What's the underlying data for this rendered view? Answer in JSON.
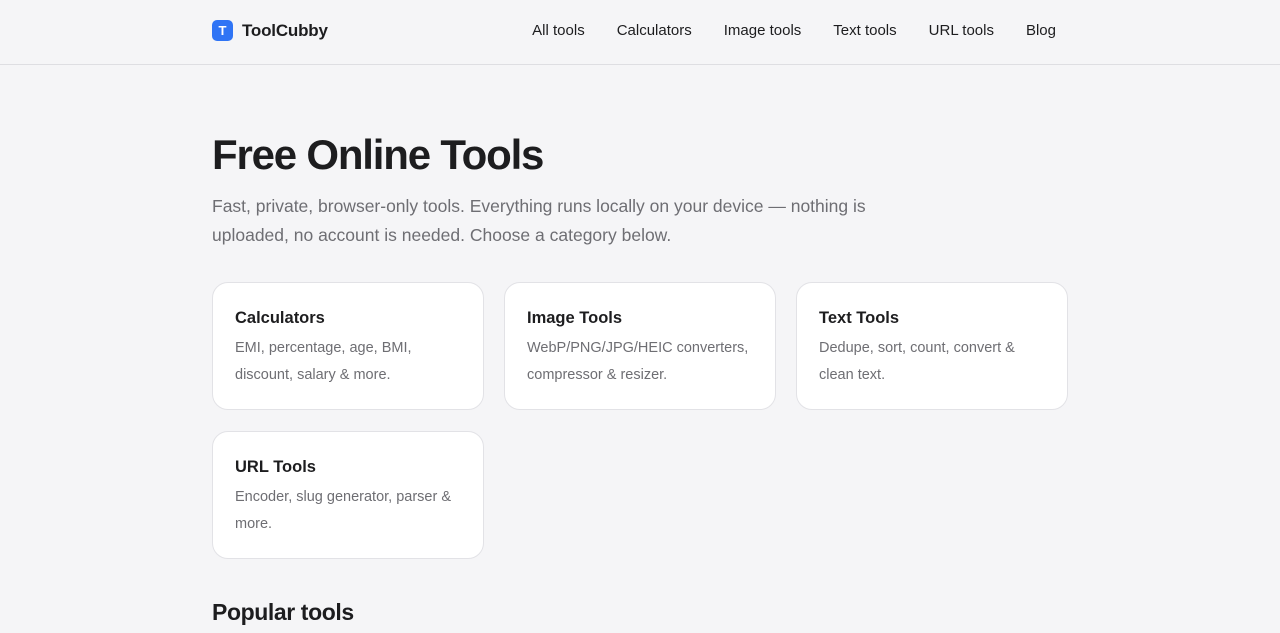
{
  "header": {
    "brand": {
      "logo_letter": "T",
      "name": "ToolCubby",
      "logo_color": "#2f74f5"
    },
    "nav": [
      {
        "label": "All tools"
      },
      {
        "label": "Calculators"
      },
      {
        "label": "Image tools"
      },
      {
        "label": "Text tools"
      },
      {
        "label": "URL tools"
      },
      {
        "label": "Blog"
      }
    ]
  },
  "hero": {
    "title": "Free Online Tools",
    "subtitle": "Fast, private, browser-only tools. Everything runs locally on your device — nothing is uploaded, no account is needed. Choose a category below."
  },
  "categories": [
    {
      "title": "Calculators",
      "description": "EMI, percentage, age, BMI, discount, salary & more."
    },
    {
      "title": "Image Tools",
      "description": "WebP/PNG/JPG/HEIC converters, compressor & resizer."
    },
    {
      "title": "Text Tools",
      "description": "Dedupe, sort, count, convert & clean text."
    },
    {
      "title": "URL Tools",
      "description": "Encoder, slug generator, parser & more."
    }
  ],
  "popular": {
    "title": "Popular tools"
  },
  "colors": {
    "background": "#f5f5f7",
    "card_background": "#ffffff",
    "text_primary": "#1d1d1f",
    "text_secondary": "#6e6e73",
    "accent": "#2f74f5"
  }
}
